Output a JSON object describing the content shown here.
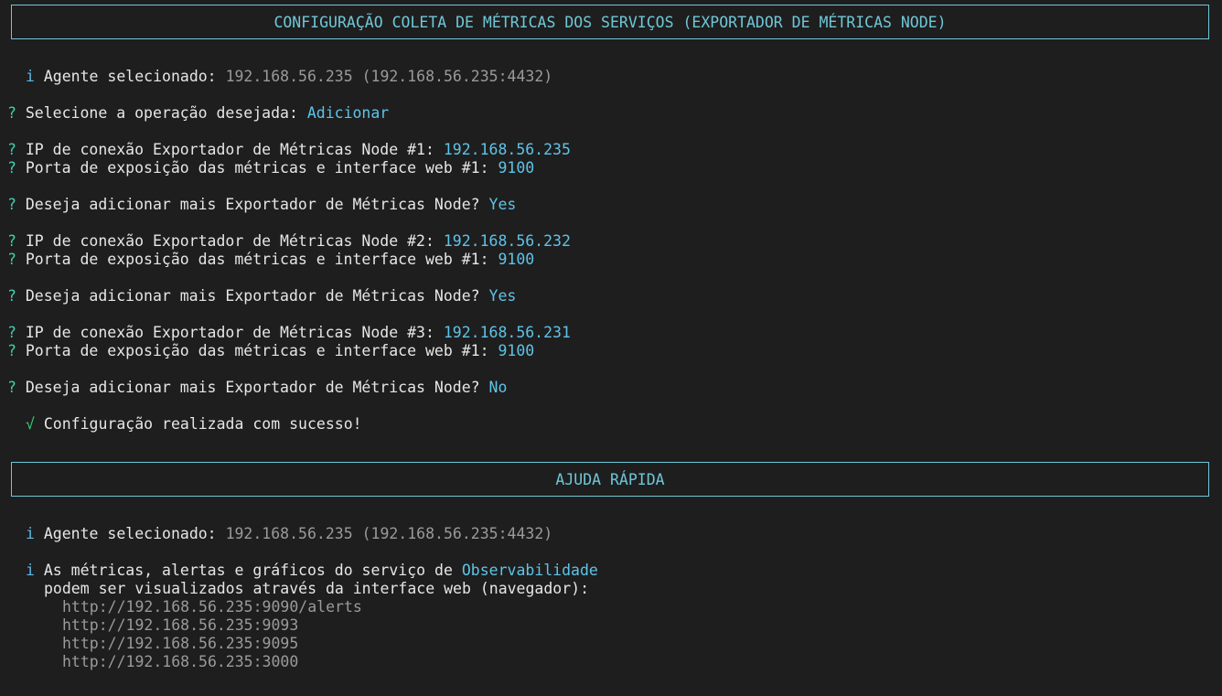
{
  "header1": "CONFIGURAÇÃO COLETA DE MÉTRICAS DOS SERVIÇOS (EXPORTADOR DE MÉTRICAS NODE)",
  "header2": "AJUDA RÁPIDA",
  "symbols": {
    "info": "i",
    "question": "?",
    "check": "√"
  },
  "agent": {
    "label": "Agente selecionado:",
    "value": "192.168.56.235 (192.168.56.235:4432)"
  },
  "operation": {
    "label": "Selecione a operação desejada:",
    "value": "Adicionar"
  },
  "exporters": [
    {
      "ip_label": "IP de conexão Exportador de Métricas Node #1:",
      "ip": "192.168.56.235",
      "port_label": "Porta de exposição das métricas e interface web #1:",
      "port": "9100",
      "more_label": "Deseja adicionar mais Exportador de Métricas Node?",
      "more": "Yes"
    },
    {
      "ip_label": "IP de conexão Exportador de Métricas Node #2:",
      "ip": "192.168.56.232",
      "port_label": "Porta de exposição das métricas e interface web #1:",
      "port": "9100",
      "more_label": "Deseja adicionar mais Exportador de Métricas Node?",
      "more": "Yes"
    },
    {
      "ip_label": "IP de conexão Exportador de Métricas Node #3:",
      "ip": "192.168.56.231",
      "port_label": "Porta de exposição das métricas e interface web #1:",
      "port": "9100",
      "more_label": "Deseja adicionar mais Exportador de Métricas Node?",
      "more": "No"
    }
  ],
  "success": "Configuração realizada com sucesso!",
  "help": {
    "agent_label": "Agente selecionado:",
    "agent_value": "192.168.56.235 (192.168.56.235:4432)",
    "obs_text": "As métricas, alertas e gráficos do serviço de",
    "obs_highlight": "Observabilidade",
    "obs_text2": "podem ser visualizados através da interface web (navegador):",
    "urls": [
      "http://192.168.56.235:9090/alerts",
      "http://192.168.56.235:9093",
      "http://192.168.56.235:9095",
      "http://192.168.56.235:3000"
    ]
  },
  "colors": {
    "background": "#1e1e1e",
    "border": "#6fc7d8",
    "question": "#3ecfa9",
    "answer": "#5fc3e8",
    "check": "#35c777",
    "muted": "#9a9a9a"
  }
}
